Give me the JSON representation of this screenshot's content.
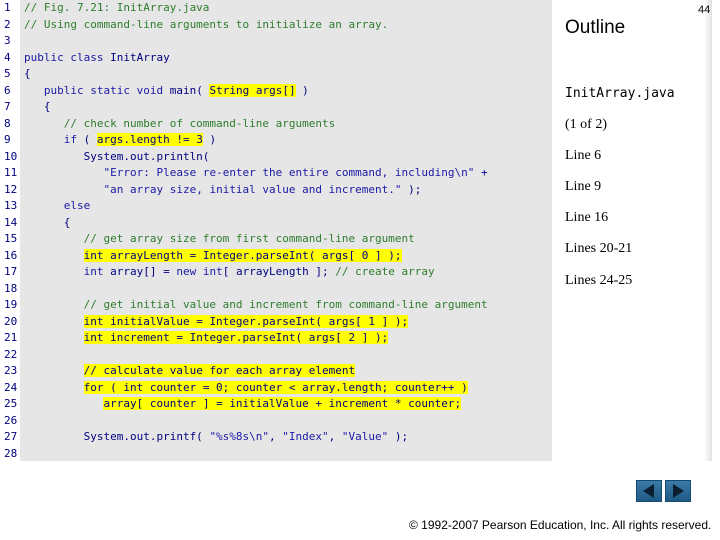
{
  "code": {
    "lines": [
      {
        "n": "1",
        "parts": [
          {
            "t": "// Fig. 7.21: InitArray.java",
            "c": "cm"
          }
        ]
      },
      {
        "n": "2",
        "parts": [
          {
            "t": "// Using command-line arguments to initialize an array.",
            "c": "cm"
          }
        ]
      },
      {
        "n": "3",
        "parts": []
      },
      {
        "n": "4",
        "parts": [
          {
            "t": "public class ",
            "c": "kw"
          },
          {
            "t": "InitArray",
            "c": ""
          }
        ]
      },
      {
        "n": "5",
        "parts": [
          {
            "t": "{",
            "c": ""
          }
        ]
      },
      {
        "n": "6",
        "parts": [
          {
            "t": "   ",
            "c": ""
          },
          {
            "t": "public static void ",
            "c": "kw"
          },
          {
            "t": "main( ",
            "c": ""
          },
          {
            "t": "String args[]",
            "c": "hl"
          },
          {
            "t": " )",
            "c": ""
          }
        ]
      },
      {
        "n": "7",
        "parts": [
          {
            "t": "   {",
            "c": ""
          }
        ]
      },
      {
        "n": "8",
        "parts": [
          {
            "t": "      // check number of command-line arguments",
            "c": "cm"
          }
        ]
      },
      {
        "n": "9",
        "parts": [
          {
            "t": "      ",
            "c": ""
          },
          {
            "t": "if",
            "c": "kw"
          },
          {
            "t": " ( ",
            "c": ""
          },
          {
            "t": "args.length != 3",
            "c": "hl"
          },
          {
            "t": " )",
            "c": ""
          }
        ]
      },
      {
        "n": "10",
        "parts": [
          {
            "t": "         System.out.println(",
            "c": ""
          }
        ]
      },
      {
        "n": "11",
        "parts": [
          {
            "t": "            ",
            "c": ""
          },
          {
            "t": "\"Error: Please re-enter the entire command, including\\n\"",
            "c": "str"
          },
          {
            "t": " +",
            "c": ""
          }
        ]
      },
      {
        "n": "12",
        "parts": [
          {
            "t": "            ",
            "c": ""
          },
          {
            "t": "\"an array size, initial value and increment.\"",
            "c": "str"
          },
          {
            "t": " );",
            "c": ""
          }
        ]
      },
      {
        "n": "13",
        "parts": [
          {
            "t": "      ",
            "c": ""
          },
          {
            "t": "else",
            "c": "kw"
          }
        ]
      },
      {
        "n": "14",
        "parts": [
          {
            "t": "      {",
            "c": ""
          }
        ]
      },
      {
        "n": "15",
        "parts": [
          {
            "t": "         // get array size from first command-line argument",
            "c": "cm"
          }
        ]
      },
      {
        "n": "16",
        "parts": [
          {
            "t": "         ",
            "c": ""
          },
          {
            "t": "int arrayLength = Integer.parseInt( args[ 0 ] );",
            "c": "hl"
          }
        ]
      },
      {
        "n": "17",
        "parts": [
          {
            "t": "         ",
            "c": ""
          },
          {
            "t": "int",
            "c": "kw"
          },
          {
            "t": " array[] = ",
            "c": ""
          },
          {
            "t": "new int",
            "c": "kw"
          },
          {
            "t": "[ arrayLength ]; ",
            "c": ""
          },
          {
            "t": "// create array",
            "c": "cm"
          }
        ]
      },
      {
        "n": "18",
        "parts": []
      },
      {
        "n": "19",
        "parts": [
          {
            "t": "         // get initial value and increment from command-line argument",
            "c": "cm"
          }
        ]
      },
      {
        "n": "20",
        "parts": [
          {
            "t": "         ",
            "c": ""
          },
          {
            "t": "int initialValue = Integer.parseInt( args[ 1 ] );",
            "c": "hl"
          }
        ]
      },
      {
        "n": "21",
        "parts": [
          {
            "t": "         ",
            "c": ""
          },
          {
            "t": "int increment = Integer.parseInt( args[ 2 ] );",
            "c": "hl"
          }
        ]
      },
      {
        "n": "22",
        "parts": []
      },
      {
        "n": "23",
        "parts": [
          {
            "t": "         ",
            "c": ""
          },
          {
            "t": "// calculate value for each array element",
            "c": "hl"
          }
        ]
      },
      {
        "n": "24",
        "parts": [
          {
            "t": "         ",
            "c": ""
          },
          {
            "t": "for ( int counter = 0; counter < array.length; counter++ )",
            "c": "hl"
          }
        ]
      },
      {
        "n": "25",
        "parts": [
          {
            "t": "            ",
            "c": ""
          },
          {
            "t": "array[ counter ] = initialValue + increment * counter;",
            "c": "hl"
          }
        ]
      },
      {
        "n": "26",
        "parts": []
      },
      {
        "n": "27",
        "parts": [
          {
            "t": "         System.out.printf( ",
            "c": ""
          },
          {
            "t": "\"%s%8s\\n\"",
            "c": "str"
          },
          {
            "t": ", ",
            "c": ""
          },
          {
            "t": "\"Index\"",
            "c": "str"
          },
          {
            "t": ", ",
            "c": ""
          },
          {
            "t": "\"Value\"",
            "c": "str"
          },
          {
            "t": " );",
            "c": ""
          }
        ]
      },
      {
        "n": "28",
        "parts": []
      }
    ]
  },
  "sidebar": {
    "title": "Outline",
    "page_number": "44",
    "filename": "InitArray.java",
    "notes": [
      "(1 of 2)",
      "Line 6",
      "Line 9",
      "Line 16",
      "Lines 20-21",
      "Lines 24-25"
    ]
  },
  "footer": {
    "copyright": "© 1992-2007 Pearson Education, Inc.  All rights reserved."
  },
  "nav": {
    "prev_icon": "triangle-left-icon",
    "next_icon": "triangle-right-icon"
  }
}
